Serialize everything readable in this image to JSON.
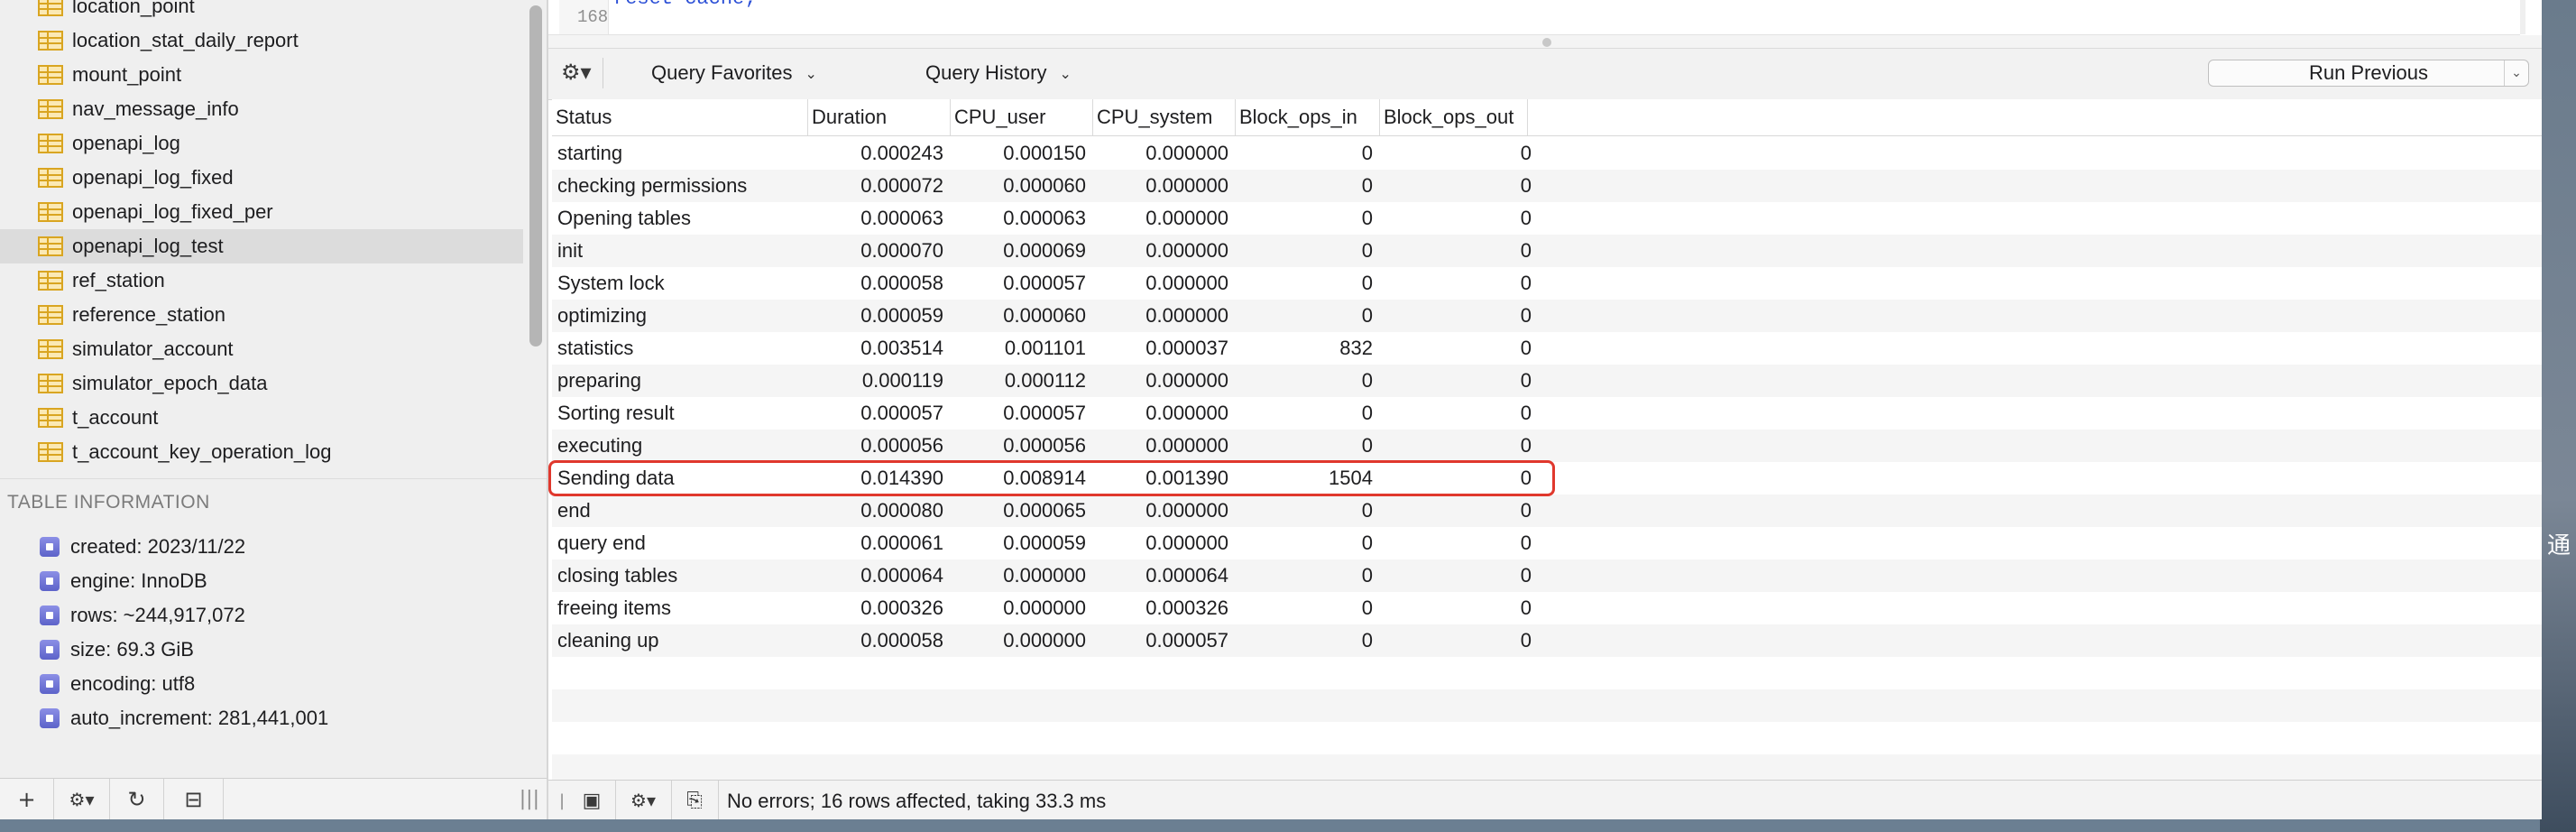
{
  "sidebar": {
    "tables": [
      {
        "name": "location_point",
        "selected": false
      },
      {
        "name": "location_stat_daily_report",
        "selected": false
      },
      {
        "name": "mount_point",
        "selected": false
      },
      {
        "name": "nav_message_info",
        "selected": false
      },
      {
        "name": "openapi_log",
        "selected": false
      },
      {
        "name": "openapi_log_fixed",
        "selected": false
      },
      {
        "name": "openapi_log_fixed_per",
        "selected": false
      },
      {
        "name": "openapi_log_test",
        "selected": true
      },
      {
        "name": "ref_station",
        "selected": false
      },
      {
        "name": "reference_station",
        "selected": false
      },
      {
        "name": "simulator_account",
        "selected": false
      },
      {
        "name": "simulator_epoch_data",
        "selected": false
      },
      {
        "name": "t_account",
        "selected": false
      },
      {
        "name": "t_account_key_operation_log",
        "selected": false
      }
    ],
    "table_info": {
      "header": "TABLE INFORMATION",
      "items": [
        "created: 2023/11/22",
        "engine: InnoDB",
        "rows: ~244,917,072",
        "size: 69.3 GiB",
        "encoding: utf8",
        "auto_increment: 281,441,001"
      ]
    },
    "toolbar": {
      "add": "+",
      "gear": "⚙▾",
      "refresh": "↻",
      "filter": "⊟",
      "grip": "|||"
    }
  },
  "editor": {
    "line_number": "168",
    "code": "reset cache;"
  },
  "query_toolbar": {
    "gear": "⚙▾",
    "favorites_label": "Query Favorites",
    "history_label": "Query History",
    "run_previous_label": "Run Previous"
  },
  "results": {
    "columns": [
      "Status",
      "Duration",
      "CPU_user",
      "CPU_system",
      "Block_ops_in",
      "Block_ops_out"
    ],
    "rows": [
      [
        "starting",
        "0.000243",
        "0.000150",
        "0.000000",
        "0",
        "0"
      ],
      [
        "checking permissions",
        "0.000072",
        "0.000060",
        "0.000000",
        "0",
        "0"
      ],
      [
        "Opening tables",
        "0.000063",
        "0.000063",
        "0.000000",
        "0",
        "0"
      ],
      [
        "init",
        "0.000070",
        "0.000069",
        "0.000000",
        "0",
        "0"
      ],
      [
        "System lock",
        "0.000058",
        "0.000057",
        "0.000000",
        "0",
        "0"
      ],
      [
        "optimizing",
        "0.000059",
        "0.000060",
        "0.000000",
        "0",
        "0"
      ],
      [
        "statistics",
        "0.003514",
        "0.001101",
        "0.000037",
        "832",
        "0"
      ],
      [
        "preparing",
        "0.000119",
        "0.000112",
        "0.000000",
        "0",
        "0"
      ],
      [
        "Sorting result",
        "0.000057",
        "0.000057",
        "0.000000",
        "0",
        "0"
      ],
      [
        "executing",
        "0.000056",
        "0.000056",
        "0.000000",
        "0",
        "0"
      ],
      [
        "Sending data",
        "0.014390",
        "0.008914",
        "0.001390",
        "1504",
        "0"
      ],
      [
        "end",
        "0.000080",
        "0.000065",
        "0.000000",
        "0",
        "0"
      ],
      [
        "query end",
        "0.000061",
        "0.000059",
        "0.000000",
        "0",
        "0"
      ],
      [
        "closing tables",
        "0.000064",
        "0.000000",
        "0.000064",
        "0",
        "0"
      ],
      [
        "freeing items",
        "0.000326",
        "0.000000",
        "0.000326",
        "0",
        "0"
      ],
      [
        "cleaning up",
        "0.000058",
        "0.000000",
        "0.000057",
        "0",
        "0"
      ]
    ],
    "highlighted_row": "Sending data"
  },
  "statusbar": {
    "message": "No errors; 16 rows affected, taking 33.3 ms",
    "gear": "⚙▾"
  },
  "desktop": {
    "glyph": "通"
  },
  "colors": {
    "highlight_border": "#e0382d",
    "selected_row": "#dcdcdc",
    "table_icon": "#d9a521",
    "property_icon": "#5d63c9"
  }
}
